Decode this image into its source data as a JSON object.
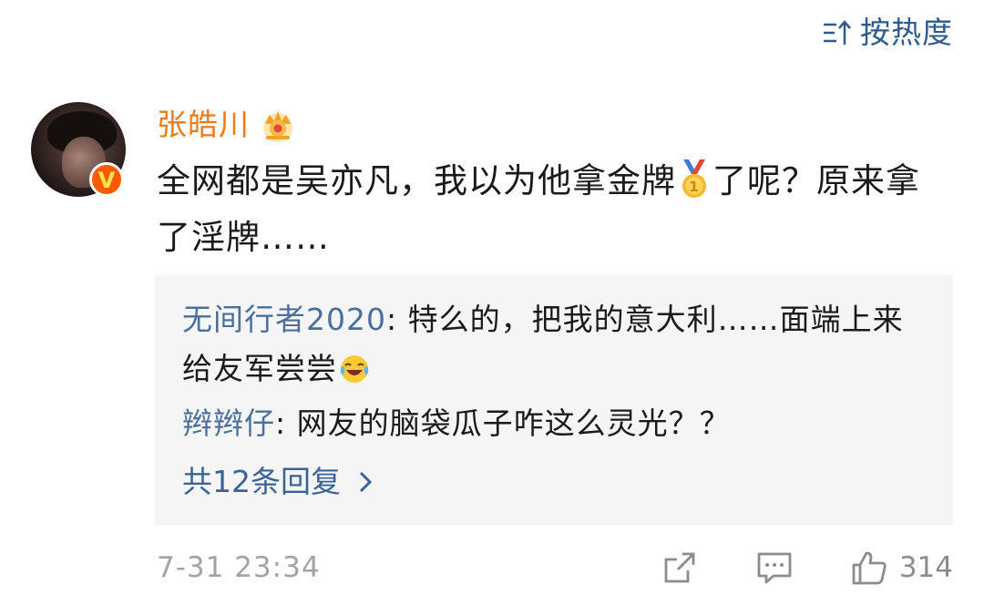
{
  "sort": {
    "icon": "sort-icon",
    "label": "按热度"
  },
  "comment": {
    "username": "张皓川",
    "username_color": "#ef7a19",
    "badge_icon": "crown-icon",
    "verified": "V",
    "text_part1": "全网都是吴亦凡，我以为他拿金牌",
    "emoji": "medal-icon",
    "text_part2": "了呢？原来拿了淫牌……",
    "timestamp": "7-31 23:34",
    "like_count": "314"
  },
  "replies": [
    {
      "user": "无间行者2020",
      "separator": ": ",
      "text": "特么的，把我的意大利……面端上来给友军尝尝",
      "emoji": "laugh-cry-emoji"
    },
    {
      "user": "辫辫仔",
      "separator": ": ",
      "text": "网友的脑袋瓜子咋这么灵光？？"
    }
  ],
  "more_replies": {
    "label": "共12条回复",
    "icon": "chevron-right-icon"
  },
  "colors": {
    "accent_link": "#4a6f9d",
    "reply_bg": "#f5f5f5",
    "muted": "#a3a3a3"
  }
}
